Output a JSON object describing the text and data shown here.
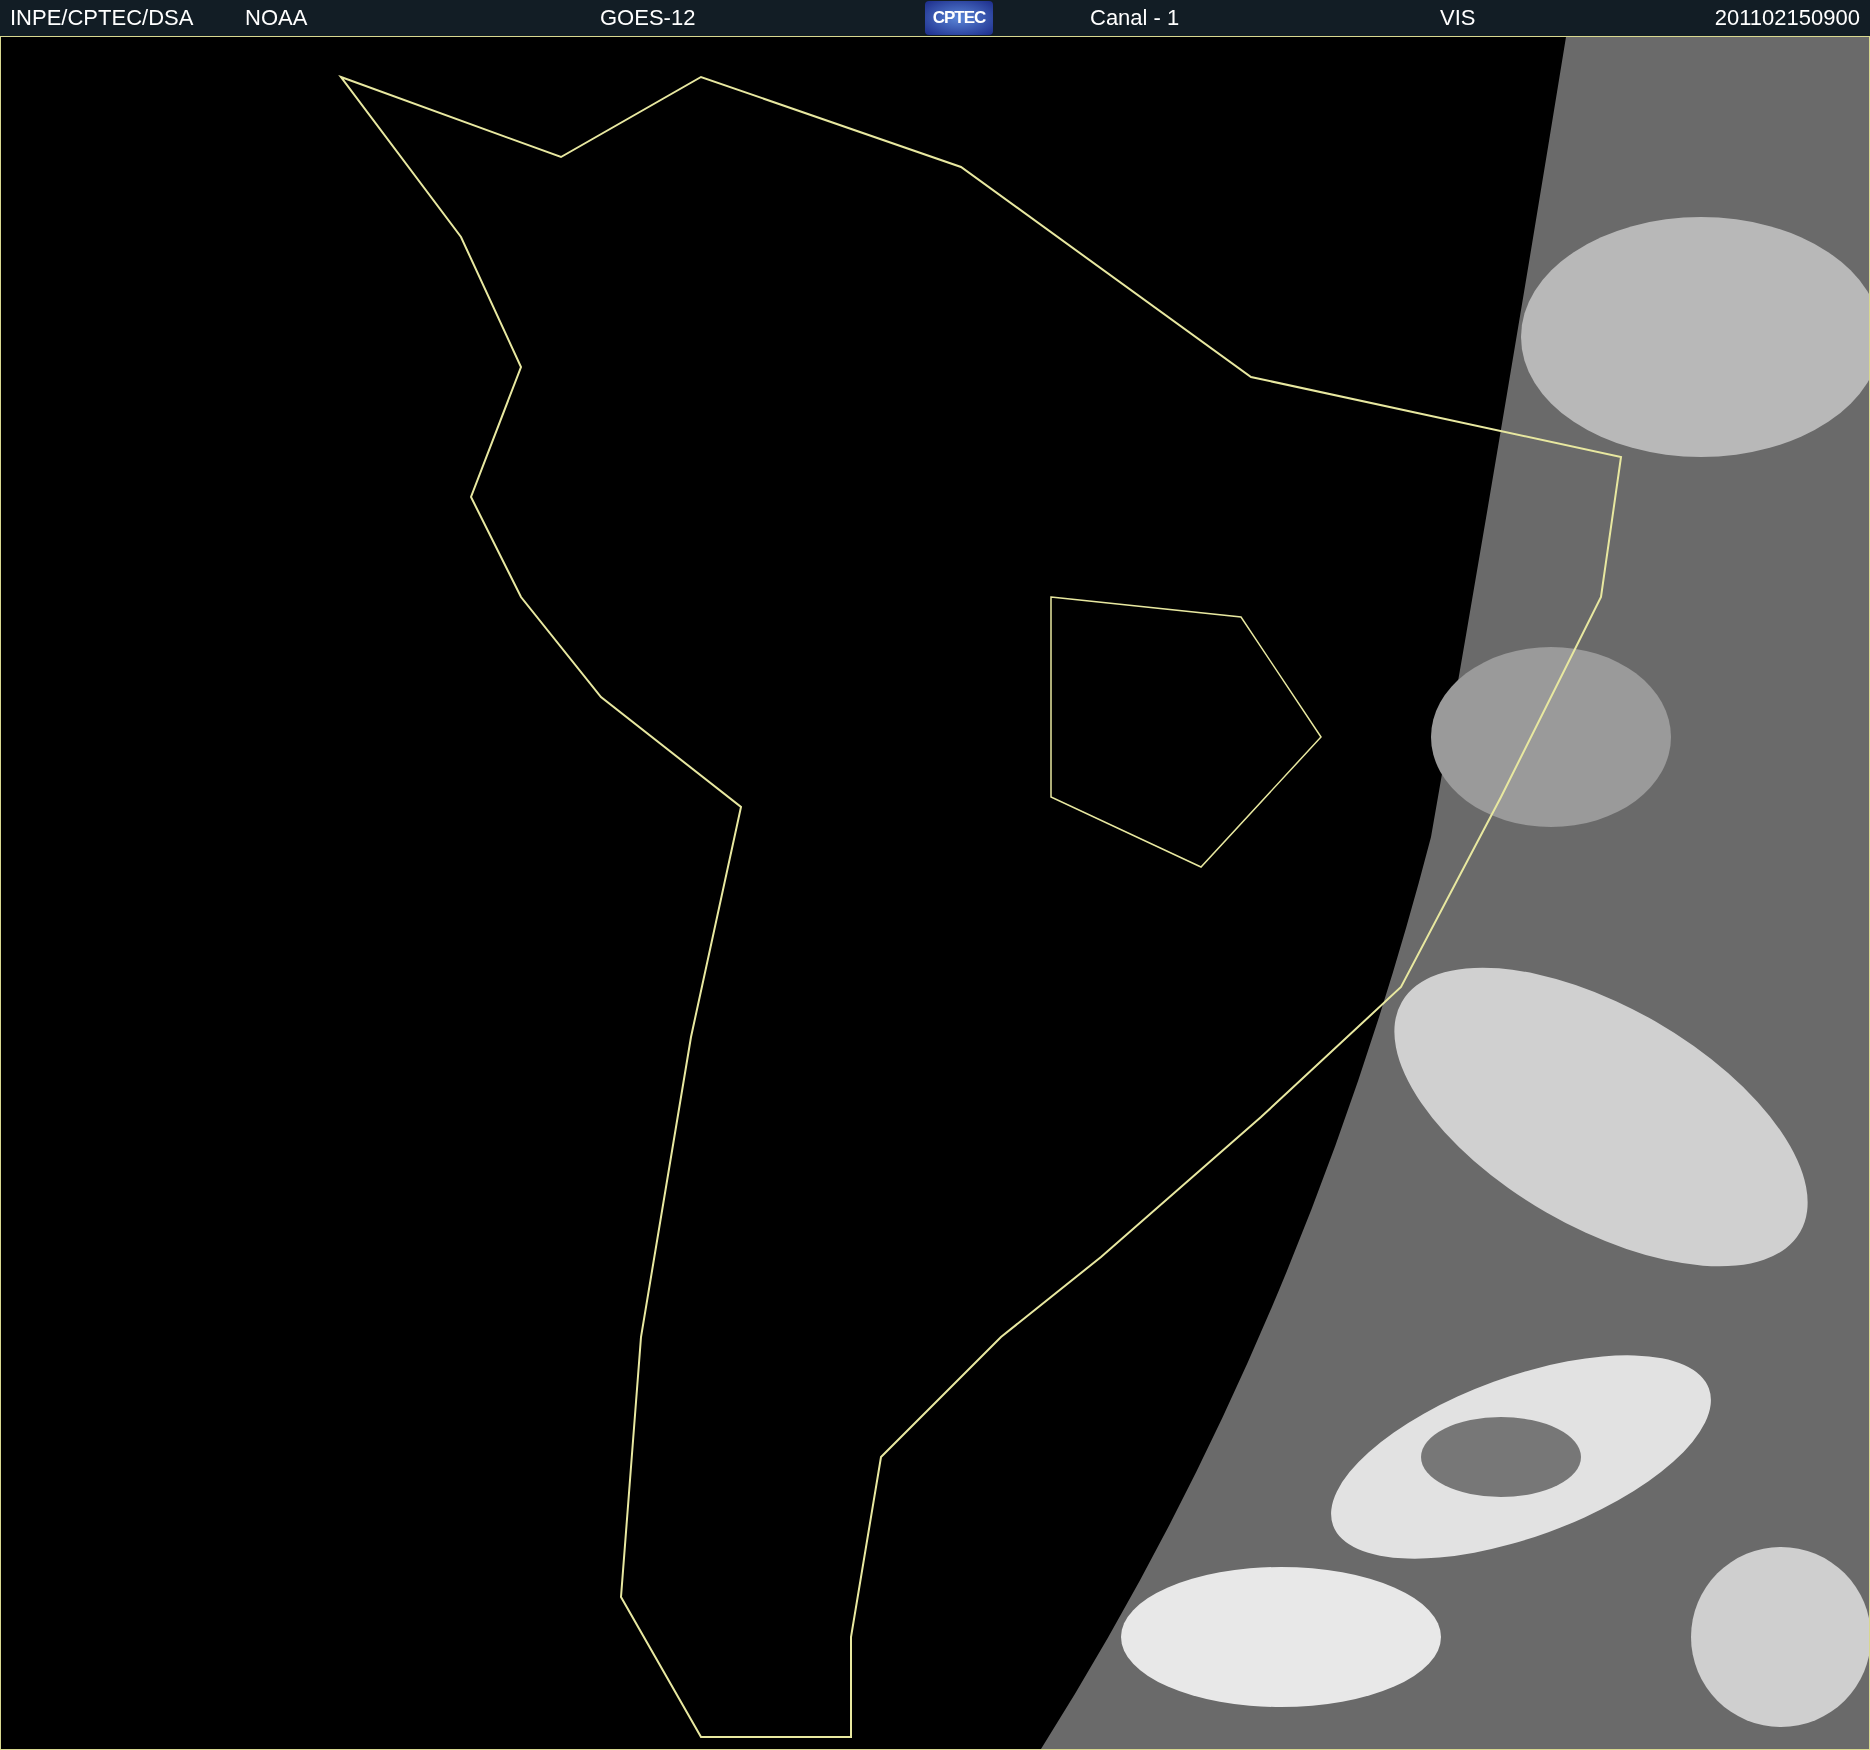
{
  "header": {
    "source": "INPE/CPTEC/DSA",
    "agency": "NOAA",
    "satellite": "GOES-12",
    "logo": "CPTEC",
    "channel": "Canal - 1",
    "band": "VIS",
    "timestamp": "201102150900"
  }
}
